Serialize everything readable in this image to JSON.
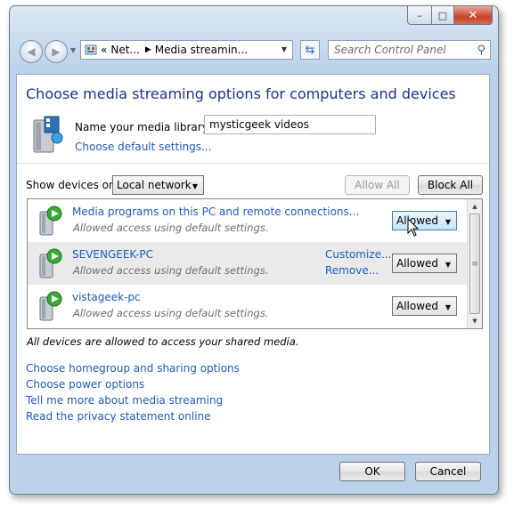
{
  "window": {
    "caption_buttons": {
      "minimize": "–",
      "maximize": "□",
      "close": "✕"
    }
  },
  "toolbar": {
    "address": {
      "prefix": "«",
      "segment1": "Net...",
      "segment2": "Media streamin..."
    },
    "search_placeholder": "Search Control Panel"
  },
  "page": {
    "title": "Choose media streaming options for computers and devices",
    "library": {
      "label": "Name your media library:",
      "value": "mysticgeek videos",
      "defaults_link": "Choose default settings..."
    },
    "show_devices": {
      "label": "Show devices on:",
      "selected": "Local network"
    },
    "buttons": {
      "allow_all": "Allow All",
      "block_all": "Block All"
    },
    "devices": [
      {
        "name": "Media programs on this PC and remote connections...",
        "status": "Allowed access using default settings.",
        "permission": "Allowed"
      },
      {
        "name": "SEVENGEEK-PC",
        "status": "Allowed access using default settings.",
        "permission": "Allowed",
        "customize": "Customize...",
        "remove": "Remove..."
      },
      {
        "name": "vistageek-pc",
        "status": "Allowed access using default settings.",
        "permission": "Allowed"
      }
    ],
    "note": "All devices are allowed to access your shared media.",
    "links": [
      "Choose homegroup and sharing options",
      "Choose power options",
      "Tell me more about media streaming",
      "Read the privacy statement online"
    ]
  },
  "footer": {
    "ok": "OK",
    "cancel": "Cancel"
  },
  "colors": {
    "title": "#1e3287",
    "link": "#1f5bbd",
    "status_text": "#6d6d6d"
  }
}
